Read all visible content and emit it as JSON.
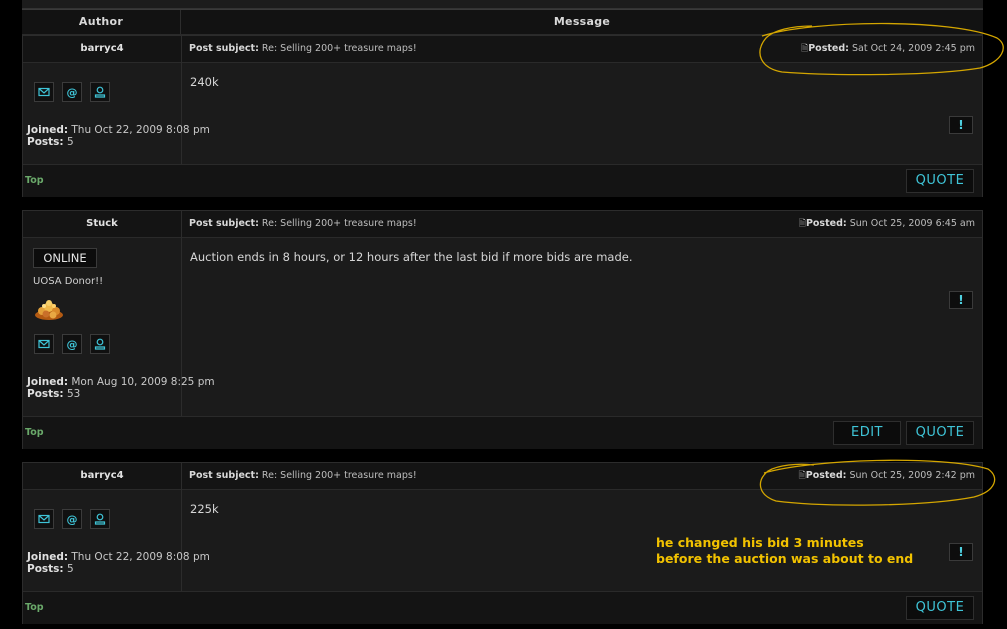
{
  "header": {
    "author": "Author",
    "message": "Message"
  },
  "posts": [
    {
      "author": "barryc4",
      "subject_label": "Post subject:",
      "subject": "Re: Selling 200+ treasure maps!",
      "posted_label": "Posted:",
      "posted": "Sat Oct 24, 2009 2:45 pm",
      "joined_label": "Joined:",
      "joined": "Thu Oct 22, 2009 8:08 pm",
      "posts_label": "Posts:",
      "post_count": "5",
      "body": "240k",
      "top": "Top",
      "quote": "QUOTE",
      "report": "!"
    },
    {
      "author": "Stuck",
      "online": "ONLINE",
      "rank": "UOSA Donor!!",
      "subject_label": "Post subject:",
      "subject": "Re: Selling 200+ treasure maps!",
      "posted_label": "Posted:",
      "posted": "Sun Oct 25, 2009 6:45 am",
      "joined_label": "Joined:",
      "joined": "Mon Aug 10, 2009 8:25 pm",
      "posts_label": "Posts:",
      "post_count": "53",
      "body": "Auction ends in 8 hours, or 12 hours after the last bid if more bids are made.",
      "top": "Top",
      "edit": "EDIT",
      "quote": "QUOTE",
      "report": "!"
    },
    {
      "author": "barryc4",
      "subject_label": "Post subject:",
      "subject": "Re: Selling 200+ treasure maps!",
      "posted_label": "Posted:",
      "posted": "Sun Oct 25, 2009 2:42 pm",
      "joined_label": "Joined:",
      "joined": "Thu Oct 22, 2009 8:08 pm",
      "posts_label": "Posts:",
      "post_count": "5",
      "body": "225k",
      "top": "Top",
      "quote": "QUOTE",
      "report": "!"
    }
  ],
  "annotation": {
    "line1": "he changed his bid 3 minutes",
    "line2": "before the auction was about to end",
    "color": "#f2c200"
  },
  "icons": [
    "envelope-icon",
    "email-at-icon",
    "profile-icon",
    "post-icon",
    "gold-pile-icon"
  ],
  "colors": {
    "accent": "#3fc5d8",
    "top_link": "#6aa96a",
    "background": "#1b1b1b"
  }
}
